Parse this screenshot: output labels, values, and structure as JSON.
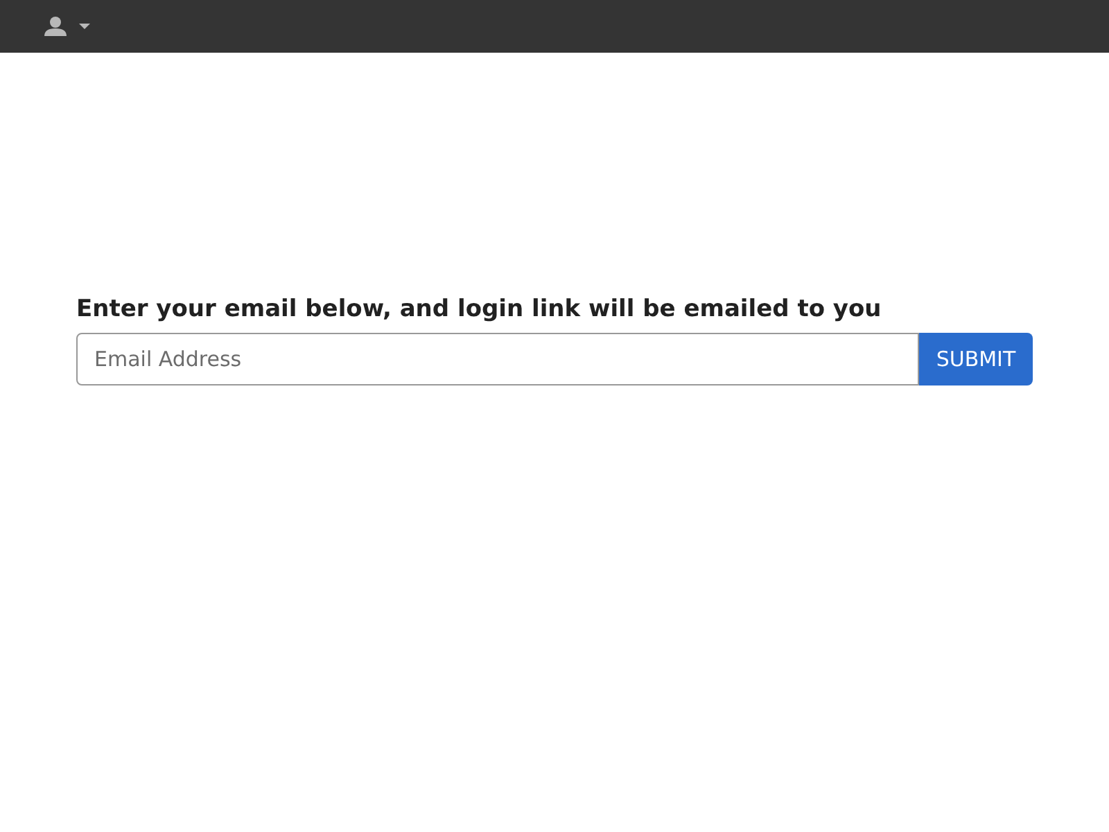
{
  "heading": "Enter your email below, and login link will be emailed to you",
  "email_field": {
    "placeholder": "Email Address"
  },
  "submit_button": "SUBMIT"
}
